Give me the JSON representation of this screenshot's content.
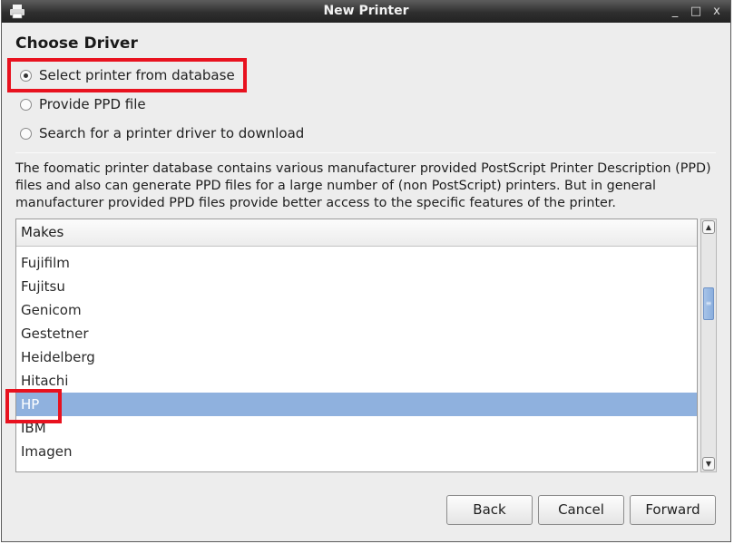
{
  "window": {
    "title": "New Printer",
    "controls": {
      "minimize": "_",
      "maximize": "□",
      "close": "x"
    }
  },
  "page": {
    "heading": "Choose Driver"
  },
  "options": [
    {
      "label": "Select printer from database",
      "selected": true
    },
    {
      "label": "Provide PPD file",
      "selected": false
    },
    {
      "label": "Search for a printer driver to download",
      "selected": false
    }
  ],
  "description": "The foomatic printer database contains various manufacturer provided PostScript Printer Description (PPD) files and also can generate PPD files for a large number of (non PostScript) printers. But in general manufacturer provided PPD files provide better access to the specific features of the printer.",
  "makes_list": {
    "header": "Makes",
    "items": [
      "Fujifilm",
      "Fujitsu",
      "Genicom",
      "Gestetner",
      "Heidelberg",
      "Hitachi",
      "HP",
      "IBM",
      "Imagen"
    ],
    "selected": "HP"
  },
  "buttons": {
    "back": "Back",
    "cancel": "Cancel",
    "forward": "Forward"
  },
  "colors": {
    "selection": "#8fb1de",
    "annotation_highlight": "#e8121f",
    "titlebar": "#2e2e2e"
  },
  "icons": {
    "app": "printer-icon",
    "scroll_up": "chevron-up-icon",
    "scroll_down": "chevron-down-icon"
  }
}
